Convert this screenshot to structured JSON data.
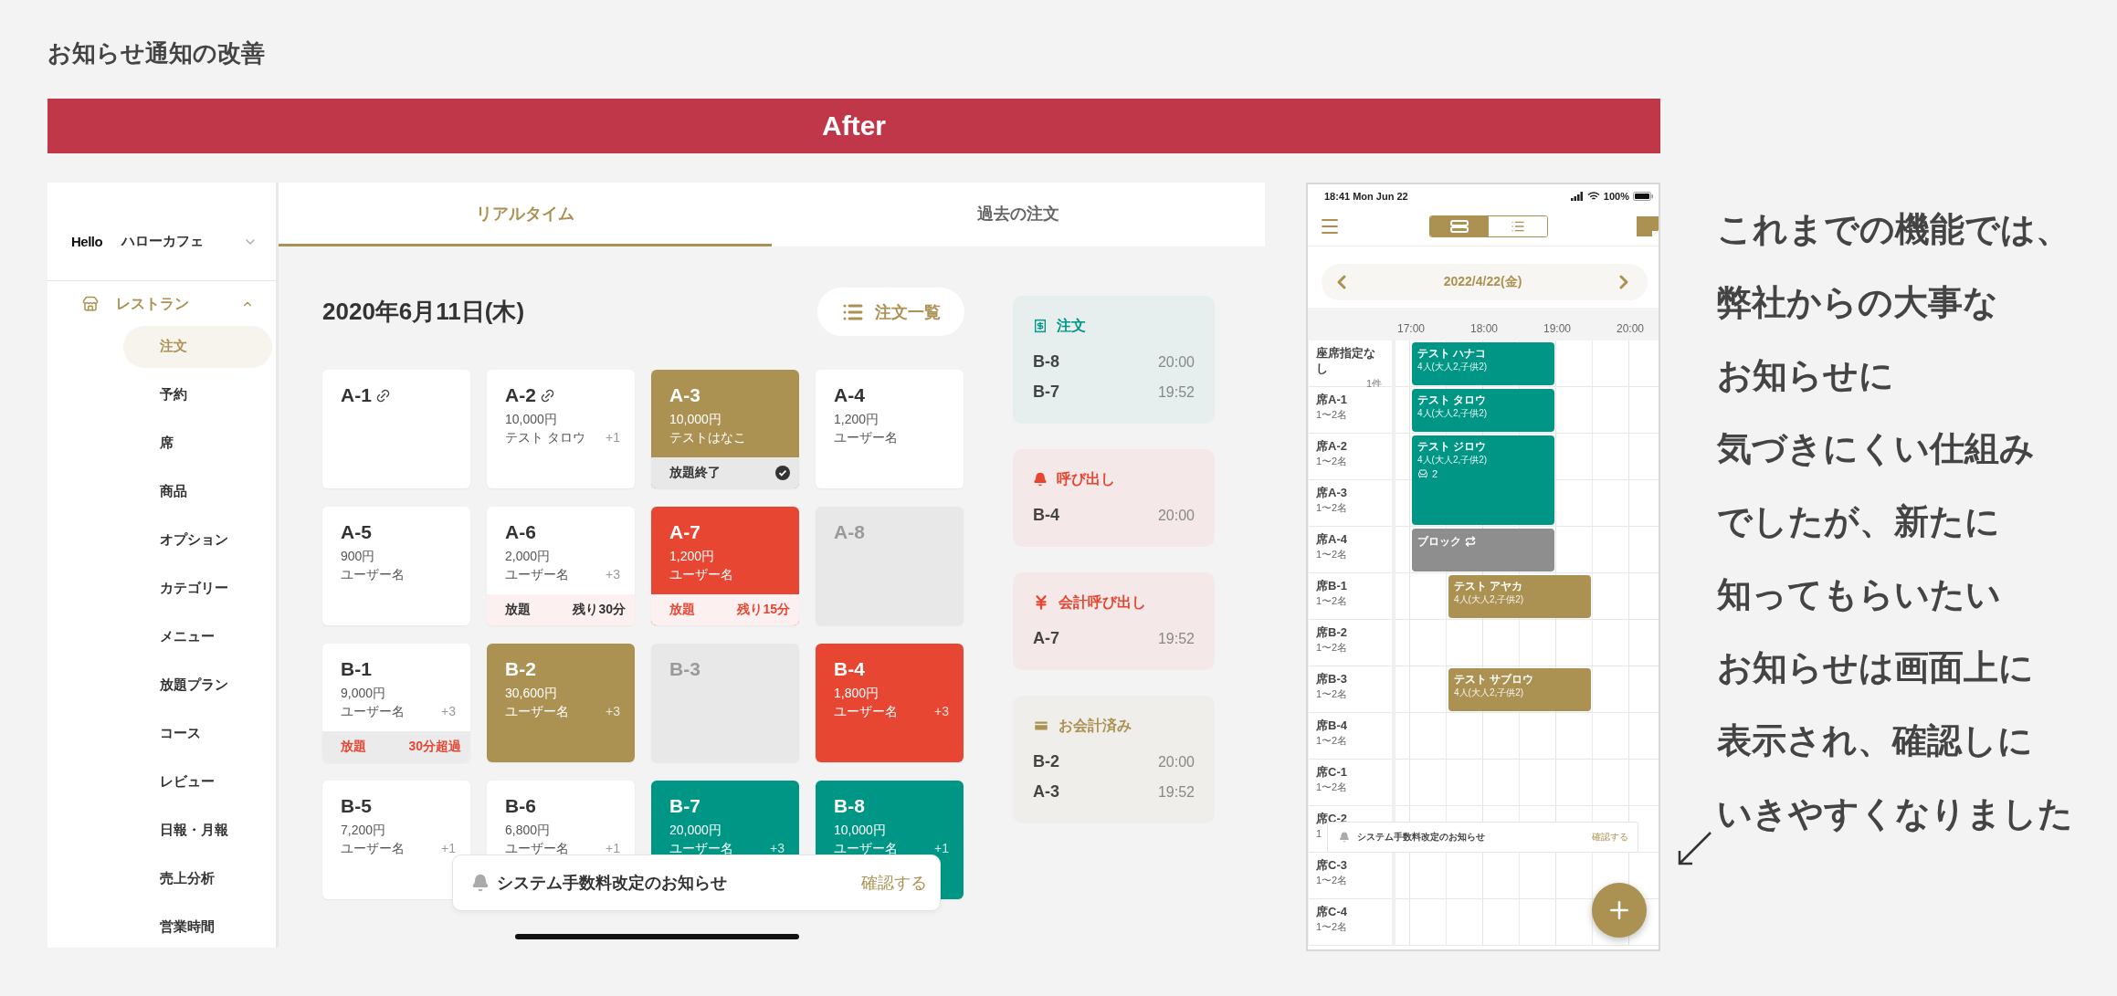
{
  "page_title": "お知らせ通知の改善",
  "banner": "After",
  "tablet": {
    "sidebar": {
      "logo": "Hello",
      "shop": "ハローカフェ",
      "section": {
        "label": "レストラン",
        "expanded": true
      },
      "items": [
        {
          "label": "注文",
          "selected": true
        },
        {
          "label": "予約",
          "selected": false
        },
        {
          "label": "席",
          "selected": false
        },
        {
          "label": "商品",
          "selected": false
        },
        {
          "label": "オプション",
          "selected": false
        },
        {
          "label": "カテゴリー",
          "selected": false
        },
        {
          "label": "メニュー",
          "selected": false
        },
        {
          "label": "放題プラン",
          "selected": false
        },
        {
          "label": "コース",
          "selected": false
        },
        {
          "label": "レビュー",
          "selected": false
        },
        {
          "label": "日報・月報",
          "selected": false
        },
        {
          "label": "売上分析",
          "selected": false
        },
        {
          "label": "営業時間",
          "selected": false
        }
      ]
    },
    "tabs": [
      {
        "label": "リアルタイム",
        "selected": true
      },
      {
        "label": "過去の注文",
        "selected": false
      }
    ],
    "date": "2020年6月11日(木)",
    "order_list_button": "注文一覧",
    "cards": [
      {
        "table": "A-1",
        "kind": "open",
        "linked": true
      },
      {
        "table": "A-2",
        "kind": "open",
        "linked": true,
        "amount": "10,000円",
        "guest": "テスト タロウ",
        "extra": "+1"
      },
      {
        "table": "A-3",
        "kind": "served",
        "amount": "10,000円",
        "guest": "テストはなこ",
        "footer": {
          "kind": "finished",
          "label": "放題終了"
        }
      },
      {
        "table": "A-4",
        "kind": "open",
        "amount": "1,200円",
        "guest": "ユーザー名"
      },
      {
        "table": "A-5",
        "kind": "open",
        "amount": "900円",
        "guest": "ユーザー名"
      },
      {
        "table": "A-6",
        "kind": "open",
        "amount": "2,000円",
        "guest": "ユーザー名",
        "extra": "+3",
        "footer": {
          "kind": "ending",
          "label": "放題",
          "value": "残り30分"
        }
      },
      {
        "table": "A-7",
        "kind": "alert",
        "amount": "1,200円",
        "guest": "ユーザー名",
        "footer": {
          "kind": "urgent",
          "label": "放題",
          "value": "残り15分"
        }
      },
      {
        "table": "A-8",
        "kind": "vacant"
      },
      {
        "table": "B-1",
        "kind": "open",
        "amount": "9,000円",
        "guest": "ユーザー名",
        "extra": "+3",
        "footer": {
          "kind": "overdue",
          "label": "放題",
          "value": "30分超過"
        }
      },
      {
        "table": "B-2",
        "kind": "served",
        "amount": "30,600円",
        "guest": "ユーザー名",
        "extra": "+3"
      },
      {
        "table": "B-3",
        "kind": "vacant"
      },
      {
        "table": "B-4",
        "kind": "alert",
        "amount": "1,800円",
        "guest": "ユーザー名",
        "extra": "+3"
      },
      {
        "table": "B-5",
        "kind": "open",
        "amount": "7,200円",
        "guest": "ユーザー名",
        "extra": "+1"
      },
      {
        "table": "B-6",
        "kind": "open",
        "amount": "6,800円",
        "guest": "ユーザー名",
        "extra": "+1"
      },
      {
        "table": "B-7",
        "kind": "ordered",
        "amount": "20,000円",
        "guest": "ユーザー名",
        "extra": "+3"
      },
      {
        "table": "B-8",
        "kind": "ordered",
        "amount": "10,000円",
        "guest": "ユーザー名",
        "extra": "+1"
      }
    ],
    "notices": [
      {
        "kind": "order",
        "title": "注文",
        "entries": [
          {
            "table": "B-8",
            "time": "20:00"
          },
          {
            "table": "B-7",
            "time": "19:52"
          }
        ]
      },
      {
        "kind": "call",
        "title": "呼び出し",
        "entries": [
          {
            "table": "B-4",
            "time": "20:00"
          }
        ]
      },
      {
        "kind": "bill_call",
        "title": "会計呼び出し",
        "entries": [
          {
            "table": "A-7",
            "time": "19:52"
          }
        ]
      },
      {
        "kind": "paid",
        "title": "お会計済み",
        "entries": [
          {
            "table": "B-2",
            "time": "20:00"
          },
          {
            "table": "A-3",
            "time": "19:52"
          }
        ]
      }
    ],
    "notification": {
      "message": "システム手数料改定のお知らせ",
      "action": "確認する"
    }
  },
  "phone": {
    "status_bar": {
      "time": "18:41 Mon Jun 22",
      "battery": "100%"
    },
    "view_toggle": [
      {
        "selected": true
      },
      {
        "selected": false
      }
    ],
    "date": "2022/4/22(金)",
    "times": [
      "17:00",
      "18:00",
      "19:00",
      "20:00"
    ],
    "seats": [
      {
        "name": "座席指定なし",
        "count": "1件"
      },
      {
        "name": "席A-1",
        "capacity": "1〜2名"
      },
      {
        "name": "席A-2",
        "capacity": "1〜2名"
      },
      {
        "name": "席A-3",
        "capacity": "1〜2名"
      },
      {
        "name": "席A-4",
        "capacity": "1〜2名"
      },
      {
        "name": "席B-1",
        "capacity": "1〜2名"
      },
      {
        "name": "席B-2",
        "capacity": "1〜2名"
      },
      {
        "name": "席B-3",
        "capacity": "1〜2名"
      },
      {
        "name": "席B-4",
        "capacity": "1〜2名"
      },
      {
        "name": "席C-1",
        "capacity": "1〜2名"
      },
      {
        "name": "席C-2",
        "capacity": "1"
      },
      {
        "name": "席C-3",
        "capacity": "1〜2名"
      },
      {
        "name": "席C-4",
        "capacity": "1〜2名"
      }
    ],
    "bookings": [
      {
        "kind": "reservation",
        "name": "テスト ハナコ",
        "detail": "4人(大人2,子供2)",
        "color": "#009685"
      },
      {
        "kind": "reservation",
        "name": "テスト タロウ",
        "detail": "4人(大人2,子供2)",
        "color": "#009685"
      },
      {
        "kind": "reservation",
        "name": "テスト ジロウ",
        "detail": "4人(大人2,子供2)",
        "seats": "2",
        "color": "#009685"
      },
      {
        "kind": "block",
        "name": "ブロック",
        "color": "#8e8e8e"
      },
      {
        "kind": "reservation",
        "name": "テスト アヤカ",
        "detail": "4人(大人2,子供2)",
        "color": "#ab9152"
      },
      {
        "kind": "reservation",
        "name": "テスト サブロウ",
        "detail": "4人(大人2,子供2)",
        "color": "#ab9152"
      }
    ],
    "notification": {
      "message": "システム手数料改定のお知らせ",
      "action": "確認する"
    }
  },
  "caption_lines": [
    "これまでの機能では、",
    "弊社からの大事な",
    "お知らせに",
    "気づきにくい仕組み",
    "でしたが、新たに",
    "知ってもらいたい",
    "お知らせは画面上に",
    "表示され、確認しに",
    "いきやすくなりました"
  ]
}
